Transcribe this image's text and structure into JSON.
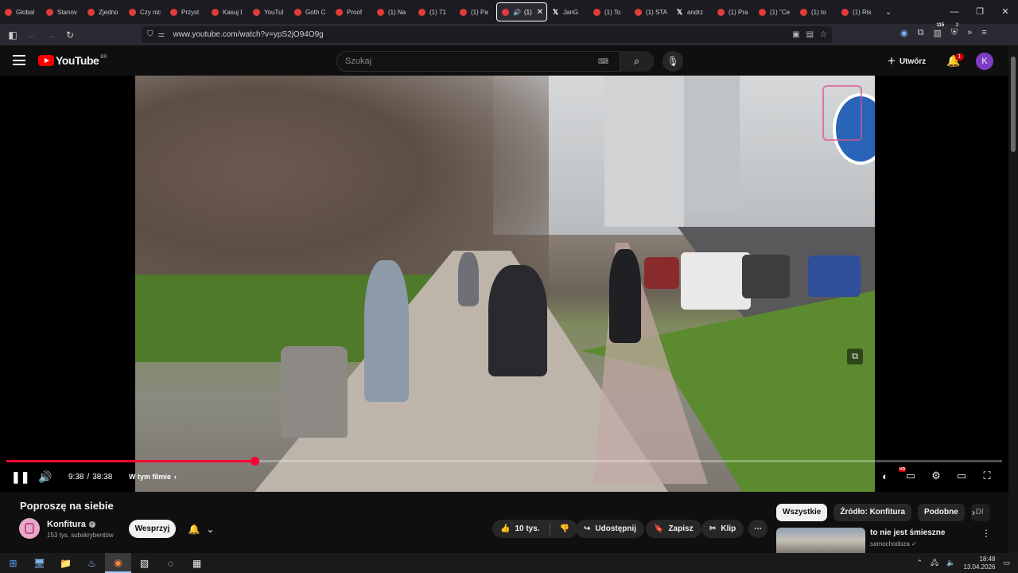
{
  "browser": {
    "tabs": [
      {
        "label": "Global",
        "favicon": "youtube-icon"
      },
      {
        "label": "Stanov",
        "favicon": "youtube-icon"
      },
      {
        "label": "Zjedno",
        "favicon": "youtube-icon"
      },
      {
        "label": "Czy nic",
        "favicon": "youtube-icon"
      },
      {
        "label": "Przyst",
        "favicon": "youtube-icon"
      },
      {
        "label": "Kasuj t",
        "favicon": "youtube-icon"
      },
      {
        "label": "YouTul",
        "favicon": "youtube-icon"
      },
      {
        "label": "Goth C",
        "favicon": "youtube-icon"
      },
      {
        "label": "Proof",
        "favicon": "youtube-icon"
      },
      {
        "label": "(1) Na",
        "favicon": "youtube-icon"
      },
      {
        "label": "(1) 71",
        "favicon": "youtube-icon"
      },
      {
        "label": "(1) Pa",
        "favicon": "youtube-icon"
      },
      {
        "label": "(1)",
        "favicon": "youtube-icon",
        "active": true
      },
      {
        "label": "JanG",
        "favicon": "x-icon"
      },
      {
        "label": "(1) To",
        "favicon": "youtube-icon"
      },
      {
        "label": "(1) STA",
        "favicon": "youtube-icon"
      },
      {
        "label": "andrz",
        "favicon": "x-icon"
      },
      {
        "label": "(1) Pra",
        "favicon": "youtube-icon"
      },
      {
        "label": "(1) \"Ce",
        "favicon": "youtube-icon"
      },
      {
        "label": "(1) to",
        "favicon": "youtube-icon"
      },
      {
        "label": "(1) Ris",
        "favicon": "youtube-icon"
      }
    ],
    "url": "www.youtube.com/watch?v=ypS2jO94O9g",
    "extension_badge_1": "115",
    "extension_badge_2": "2"
  },
  "youtube": {
    "logo": "YouTube",
    "region": "BR",
    "search_placeholder": "Szukaj",
    "create_label": "Utwórz",
    "notification_count": "1",
    "avatar_letter": "K"
  },
  "player": {
    "current_time": "9:38",
    "duration": "38:38",
    "progress_fraction": 0.2494,
    "chapter_label": "W tym filmie",
    "settings_badge": "HD"
  },
  "video_info": {
    "title": "Poproszę na siebie",
    "channel": "Konfitura",
    "subscribers": "153 tys. subskrybentów",
    "support_label": "Wesprzyj",
    "likes": "10 tys.",
    "share_label": "Udostępnij",
    "save_label": "Zapisz",
    "clip_label": "Klip"
  },
  "sidebar": {
    "chips": [
      "Wszystkie",
      "Źródło: Konfitura",
      "Podobne",
      "Dl"
    ],
    "recommendation": {
      "title": "to nie jest śmieszne",
      "channel": "samochodoza"
    }
  },
  "taskbar": {
    "time": "18:48",
    "date": "13.04.2026"
  },
  "colors": {
    "accent": "#ff0033",
    "background": "#0f0f0f",
    "avatar": "#7e3cc4"
  }
}
